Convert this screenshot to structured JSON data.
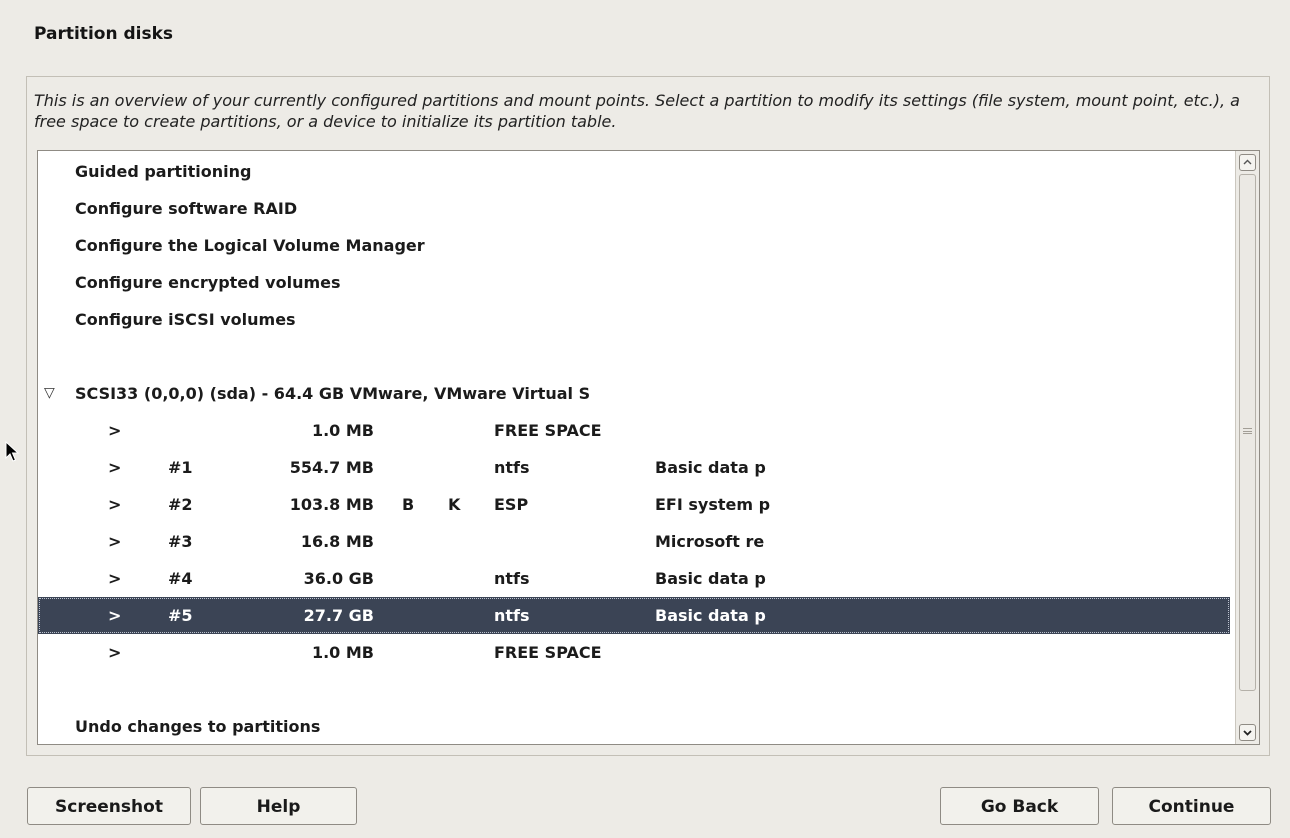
{
  "page_title": "Partition disks",
  "description": "This is an overview of your currently configured partitions and mount points. Select a partition to modify its settings (file system, mount point, etc.), a free space to create partitions, or a device to initialize its partition table.",
  "actions": [
    {
      "label": "Guided partitioning"
    },
    {
      "label": "Configure software RAID"
    },
    {
      "label": "Configure the Logical Volume Manager"
    },
    {
      "label": "Configure encrypted volumes"
    },
    {
      "label": "Configure iSCSI volumes"
    }
  ],
  "disk": {
    "expander": "▽",
    "label": "SCSI33 (0,0,0) (sda) - 64.4 GB VMware, VMware Virtual S"
  },
  "partitions": [
    {
      "arrow": ">",
      "number": "",
      "size": "1.0 MB",
      "flag1": "",
      "flag2": "",
      "fs": "FREE SPACE",
      "name": "",
      "selected": false
    },
    {
      "arrow": ">",
      "number": "#1",
      "size": "554.7 MB",
      "flag1": "",
      "flag2": "",
      "fs": "ntfs",
      "name": "Basic data p",
      "selected": false
    },
    {
      "arrow": ">",
      "number": "#2",
      "size": "103.8 MB",
      "flag1": "B",
      "flag2": "K",
      "fs": "ESP",
      "name": "EFI system p",
      "selected": false
    },
    {
      "arrow": ">",
      "number": "#3",
      "size": "16.8 MB",
      "flag1": "",
      "flag2": "",
      "fs": "",
      "name": "Microsoft re",
      "selected": false
    },
    {
      "arrow": ">",
      "number": "#4",
      "size": "36.0 GB",
      "flag1": "",
      "flag2": "",
      "fs": "ntfs",
      "name": "Basic data p",
      "selected": false
    },
    {
      "arrow": ">",
      "number": "#5",
      "size": "27.7 GB",
      "flag1": "",
      "flag2": "",
      "fs": "ntfs",
      "name": "Basic data p",
      "selected": true
    },
    {
      "arrow": ">",
      "number": "",
      "size": "1.0 MB",
      "flag1": "",
      "flag2": "",
      "fs": "FREE SPACE",
      "name": "",
      "selected": false
    }
  ],
  "undo_label": "Undo changes to partitions",
  "scrollbar": {
    "up_icon": "chevron-up-icon",
    "down_icon": "chevron-down-icon"
  },
  "buttons": {
    "screenshot": "Screenshot",
    "help": "Help",
    "go_back": "Go Back",
    "continue": "Continue"
  },
  "colors": {
    "background": "#edebe6",
    "selection": "#3b4455",
    "list_background": "#ffffff"
  }
}
